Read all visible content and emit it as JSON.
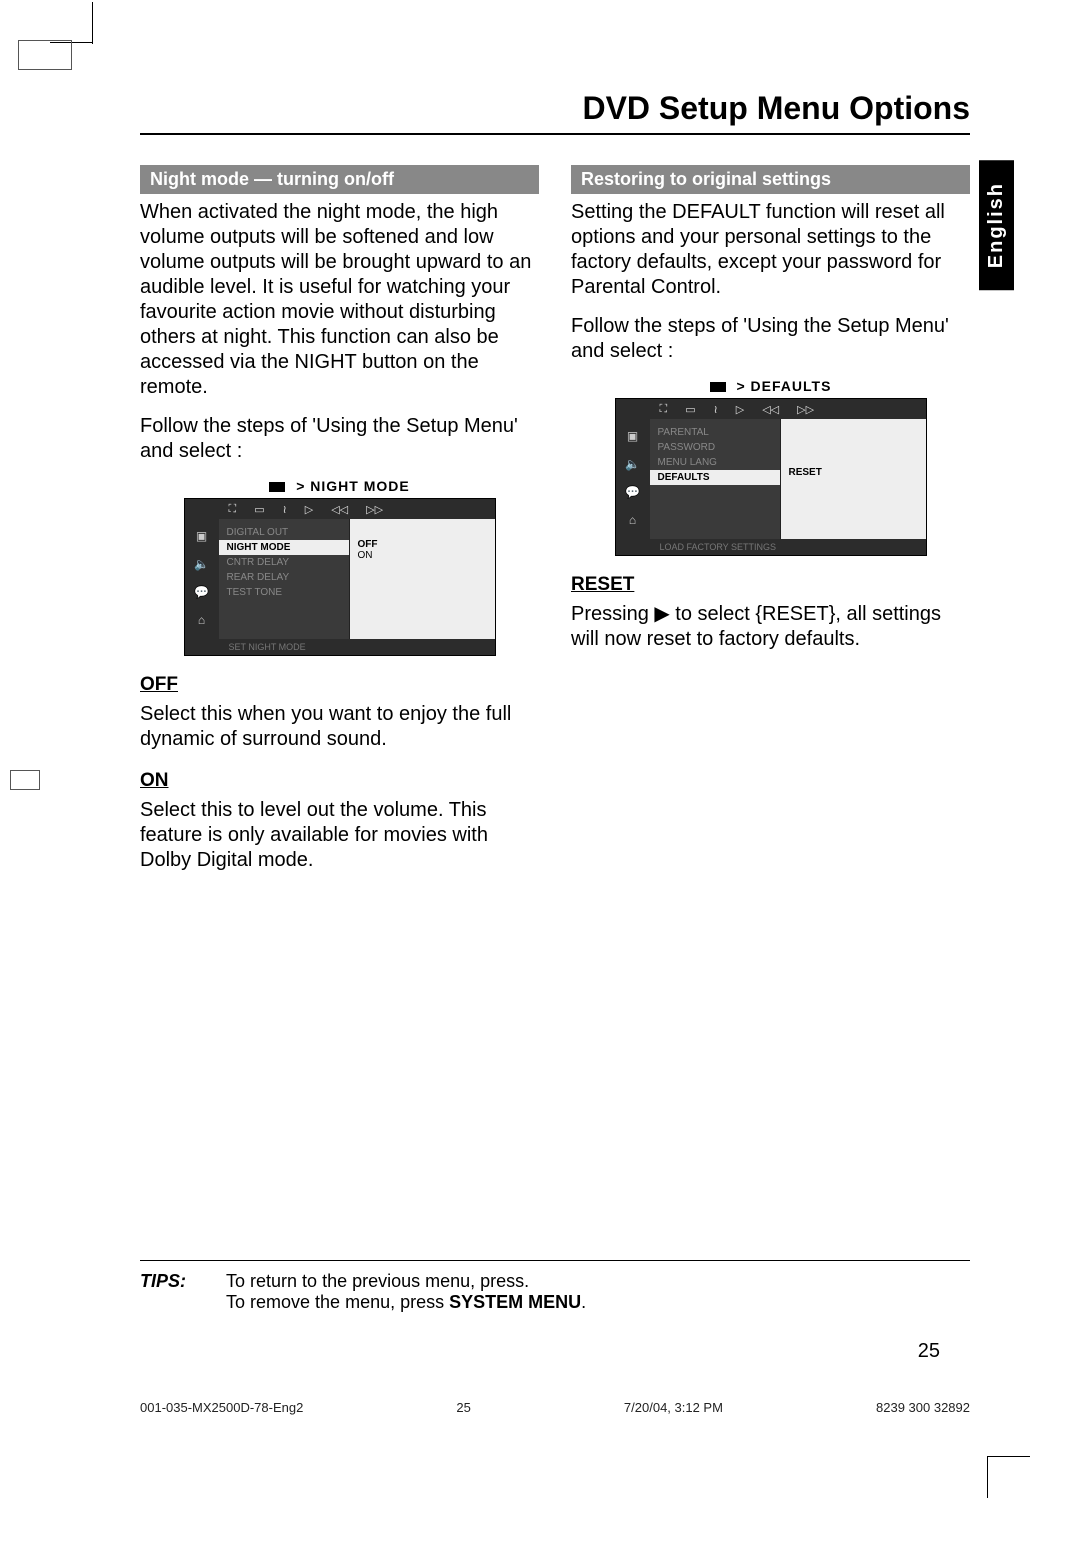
{
  "title": "DVD Setup Menu Options",
  "language_tab": "English",
  "left": {
    "header": "Night mode — turning on/off",
    "para1": "When activated the night mode, the high volume outputs will be softened and low volume outputs will be brought upward to an audible level.  It is useful for watching your favourite action movie without disturbing others at night. This function can also be accessed via the NIGHT button on the remote.",
    "para2": "Follow the steps of 'Using the Setup Menu' and select :",
    "diagram_caption": "> NIGHT MODE",
    "menu": {
      "items": [
        "DIGITAL OUT",
        "NIGHT MODE",
        "CNTR DELAY",
        "REAR DELAY",
        "TEST TONE"
      ],
      "active": "NIGHT MODE",
      "values": [
        "OFF",
        "ON"
      ],
      "value_highlight": "OFF",
      "footer": "SET NIGHT MODE"
    },
    "off_head": "OFF",
    "off_body": "Select this when you want to enjoy the full dynamic of surround sound.",
    "on_head": "ON",
    "on_body": "Select this to level out the volume. This feature is only available for movies with Dolby Digital mode."
  },
  "right": {
    "header": "Restoring to original settings",
    "para1": "Setting the DEFAULT function will reset all options and your personal settings to the factory defaults, except your password for Parental Control.",
    "para2": "Follow the steps of 'Using the Setup Menu' and select :",
    "diagram_caption": "> DEFAULTS",
    "menu": {
      "items": [
        "PARENTAL",
        "PASSWORD",
        "MENU LANG",
        "DEFAULTS"
      ],
      "active": "DEFAULTS",
      "values": [
        "RESET"
      ],
      "value_highlight": "RESET",
      "footer": "LOAD FACTORY SETTINGS"
    },
    "reset_head": "RESET",
    "reset_body": "Pressing ▶ to select {RESET},  all settings will now reset to factory defaults."
  },
  "tips": {
    "label": "TIPS:",
    "line1": "To return to the previous menu, press.",
    "line2a": "To remove the menu, press ",
    "line2b": "SYSTEM MENU",
    "line2c": "."
  },
  "page_number": "25",
  "footer": {
    "file": "001-035-MX2500D-78-Eng2",
    "pg": "25",
    "date": "7/20/04, 3:12 PM",
    "code": "8239 300 32892"
  }
}
